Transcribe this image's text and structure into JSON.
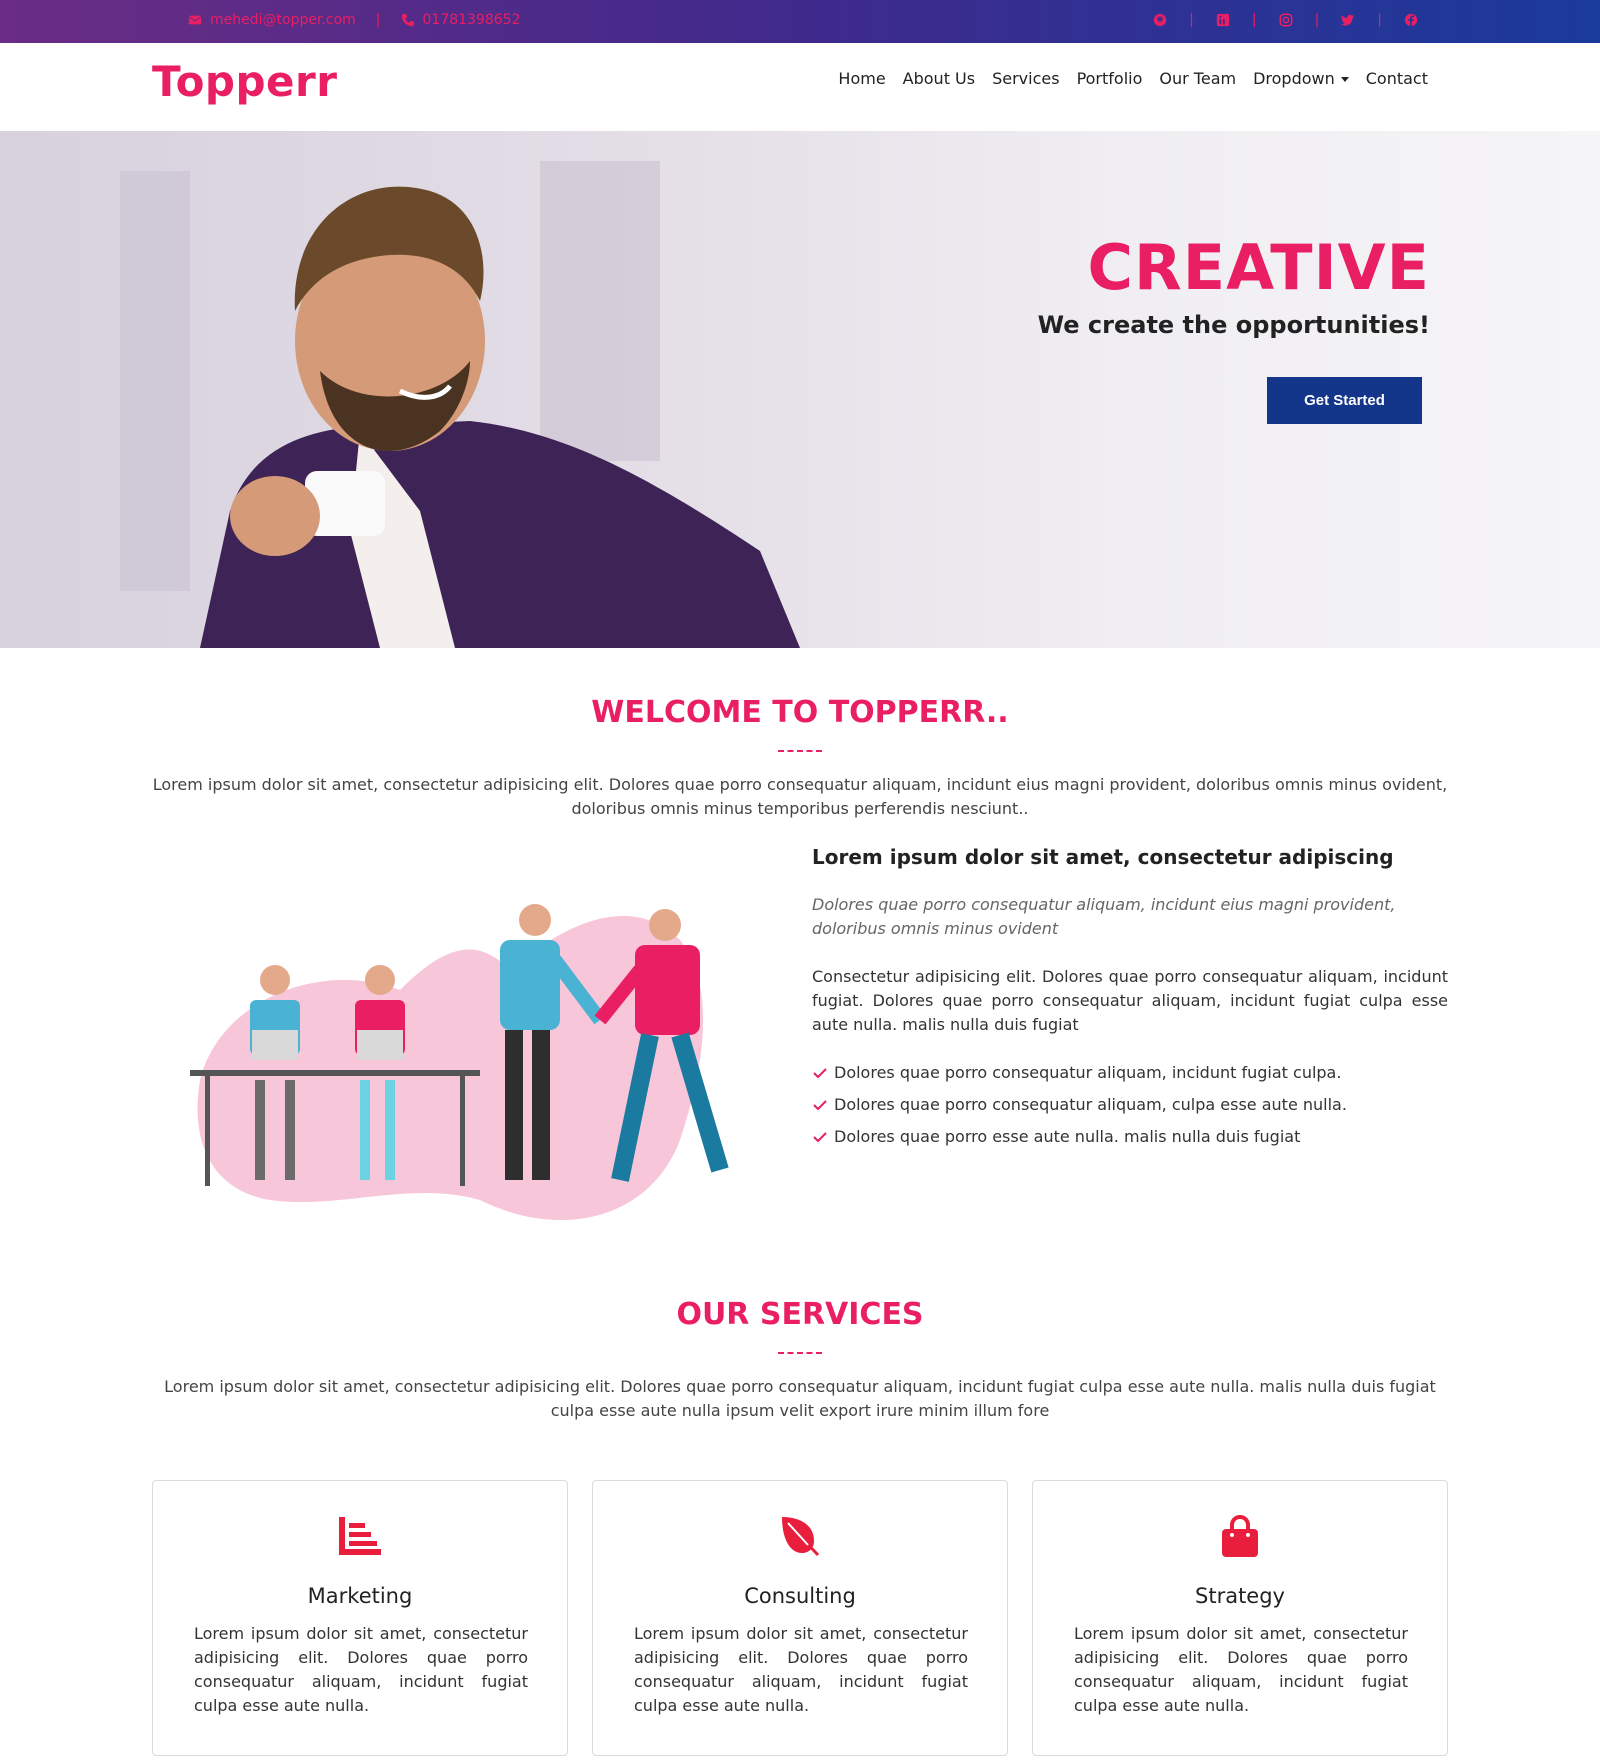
{
  "topbar": {
    "email": "mehedi@topper.com",
    "phone": "01781398652",
    "separator": "|",
    "social_icons": [
      "github-icon",
      "linkedin-icon",
      "instagram-icon",
      "twitter-icon",
      "facebook-icon"
    ]
  },
  "navbar": {
    "brand": "Topperr",
    "items": [
      "Home",
      "About Us",
      "Services",
      "Portfolio",
      "Our Team",
      "Dropdown",
      "Contact"
    ]
  },
  "hero": {
    "title": "CREATIVE",
    "subtitle": "We create the opportunities!",
    "button": "Get Started"
  },
  "welcome": {
    "title": "WELCOME TO TOPPERR..",
    "dash": "-----",
    "text": "Lorem ipsum dolor sit amet, consectetur adipisicing elit. Dolores quae porro consequatur aliquam, incidunt eius magni provident, doloribus omnis minus ovident, doloribus omnis minus temporibus perferendis nesciunt..",
    "heading": "Lorem ipsum dolor sit amet, consectetur adipiscing",
    "italic": "Dolores quae porro consequatur aliquam, incidunt eius magni provident, doloribus omnis minus ovident",
    "paragraph": "Consectetur adipisicing elit. Dolores quae porro consequatur aliquam, incidunt fugiat. Dolores quae porro consequatur aliquam, incidunt fugiat culpa esse aute nulla. malis nulla duis fugiat",
    "list": [
      "Dolores quae porro consequatur aliquam, incidunt fugiat culpa.",
      "Dolores quae porro consequatur aliquam, culpa esse aute nulla.",
      "Dolores quae porro esse aute nulla. malis nulla duis fugiat"
    ]
  },
  "services": {
    "title": "OUR SERVICES",
    "dash": "-----",
    "text": "Lorem ipsum dolor sit amet, consectetur adipisicing elit. Dolores quae porro consequatur aliquam, incidunt fugiat culpa esse aute nulla. malis nulla duis fugiat culpa esse aute nulla ipsum velit export irure minim illum fore",
    "cards": [
      {
        "icon": "bar-chart-icon",
        "title": "Marketing",
        "text": "Lorem ipsum dolor sit amet, consectetur adipisicing elit. Dolores quae porro consequatur aliquam, incidunt fugiat culpa esse aute nulla."
      },
      {
        "icon": "leaf-icon",
        "title": "Consulting",
        "text": "Lorem ipsum dolor sit amet, consectetur adipisicing elit. Dolores quae porro consequatur aliquam, incidunt fugiat culpa esse aute nulla."
      },
      {
        "icon": "shopping-bag-icon",
        "title": "Strategy",
        "text": "Lorem ipsum dolor sit amet, consectetur adipisicing elit. Dolores quae porro consequatur aliquam, incidunt fugiat culpa esse aute nulla."
      }
    ]
  },
  "colors": {
    "accent": "#e91e63",
    "button": "#13358a",
    "topbar_start": "#6a2c84",
    "topbar_end": "#1a3a9c"
  }
}
